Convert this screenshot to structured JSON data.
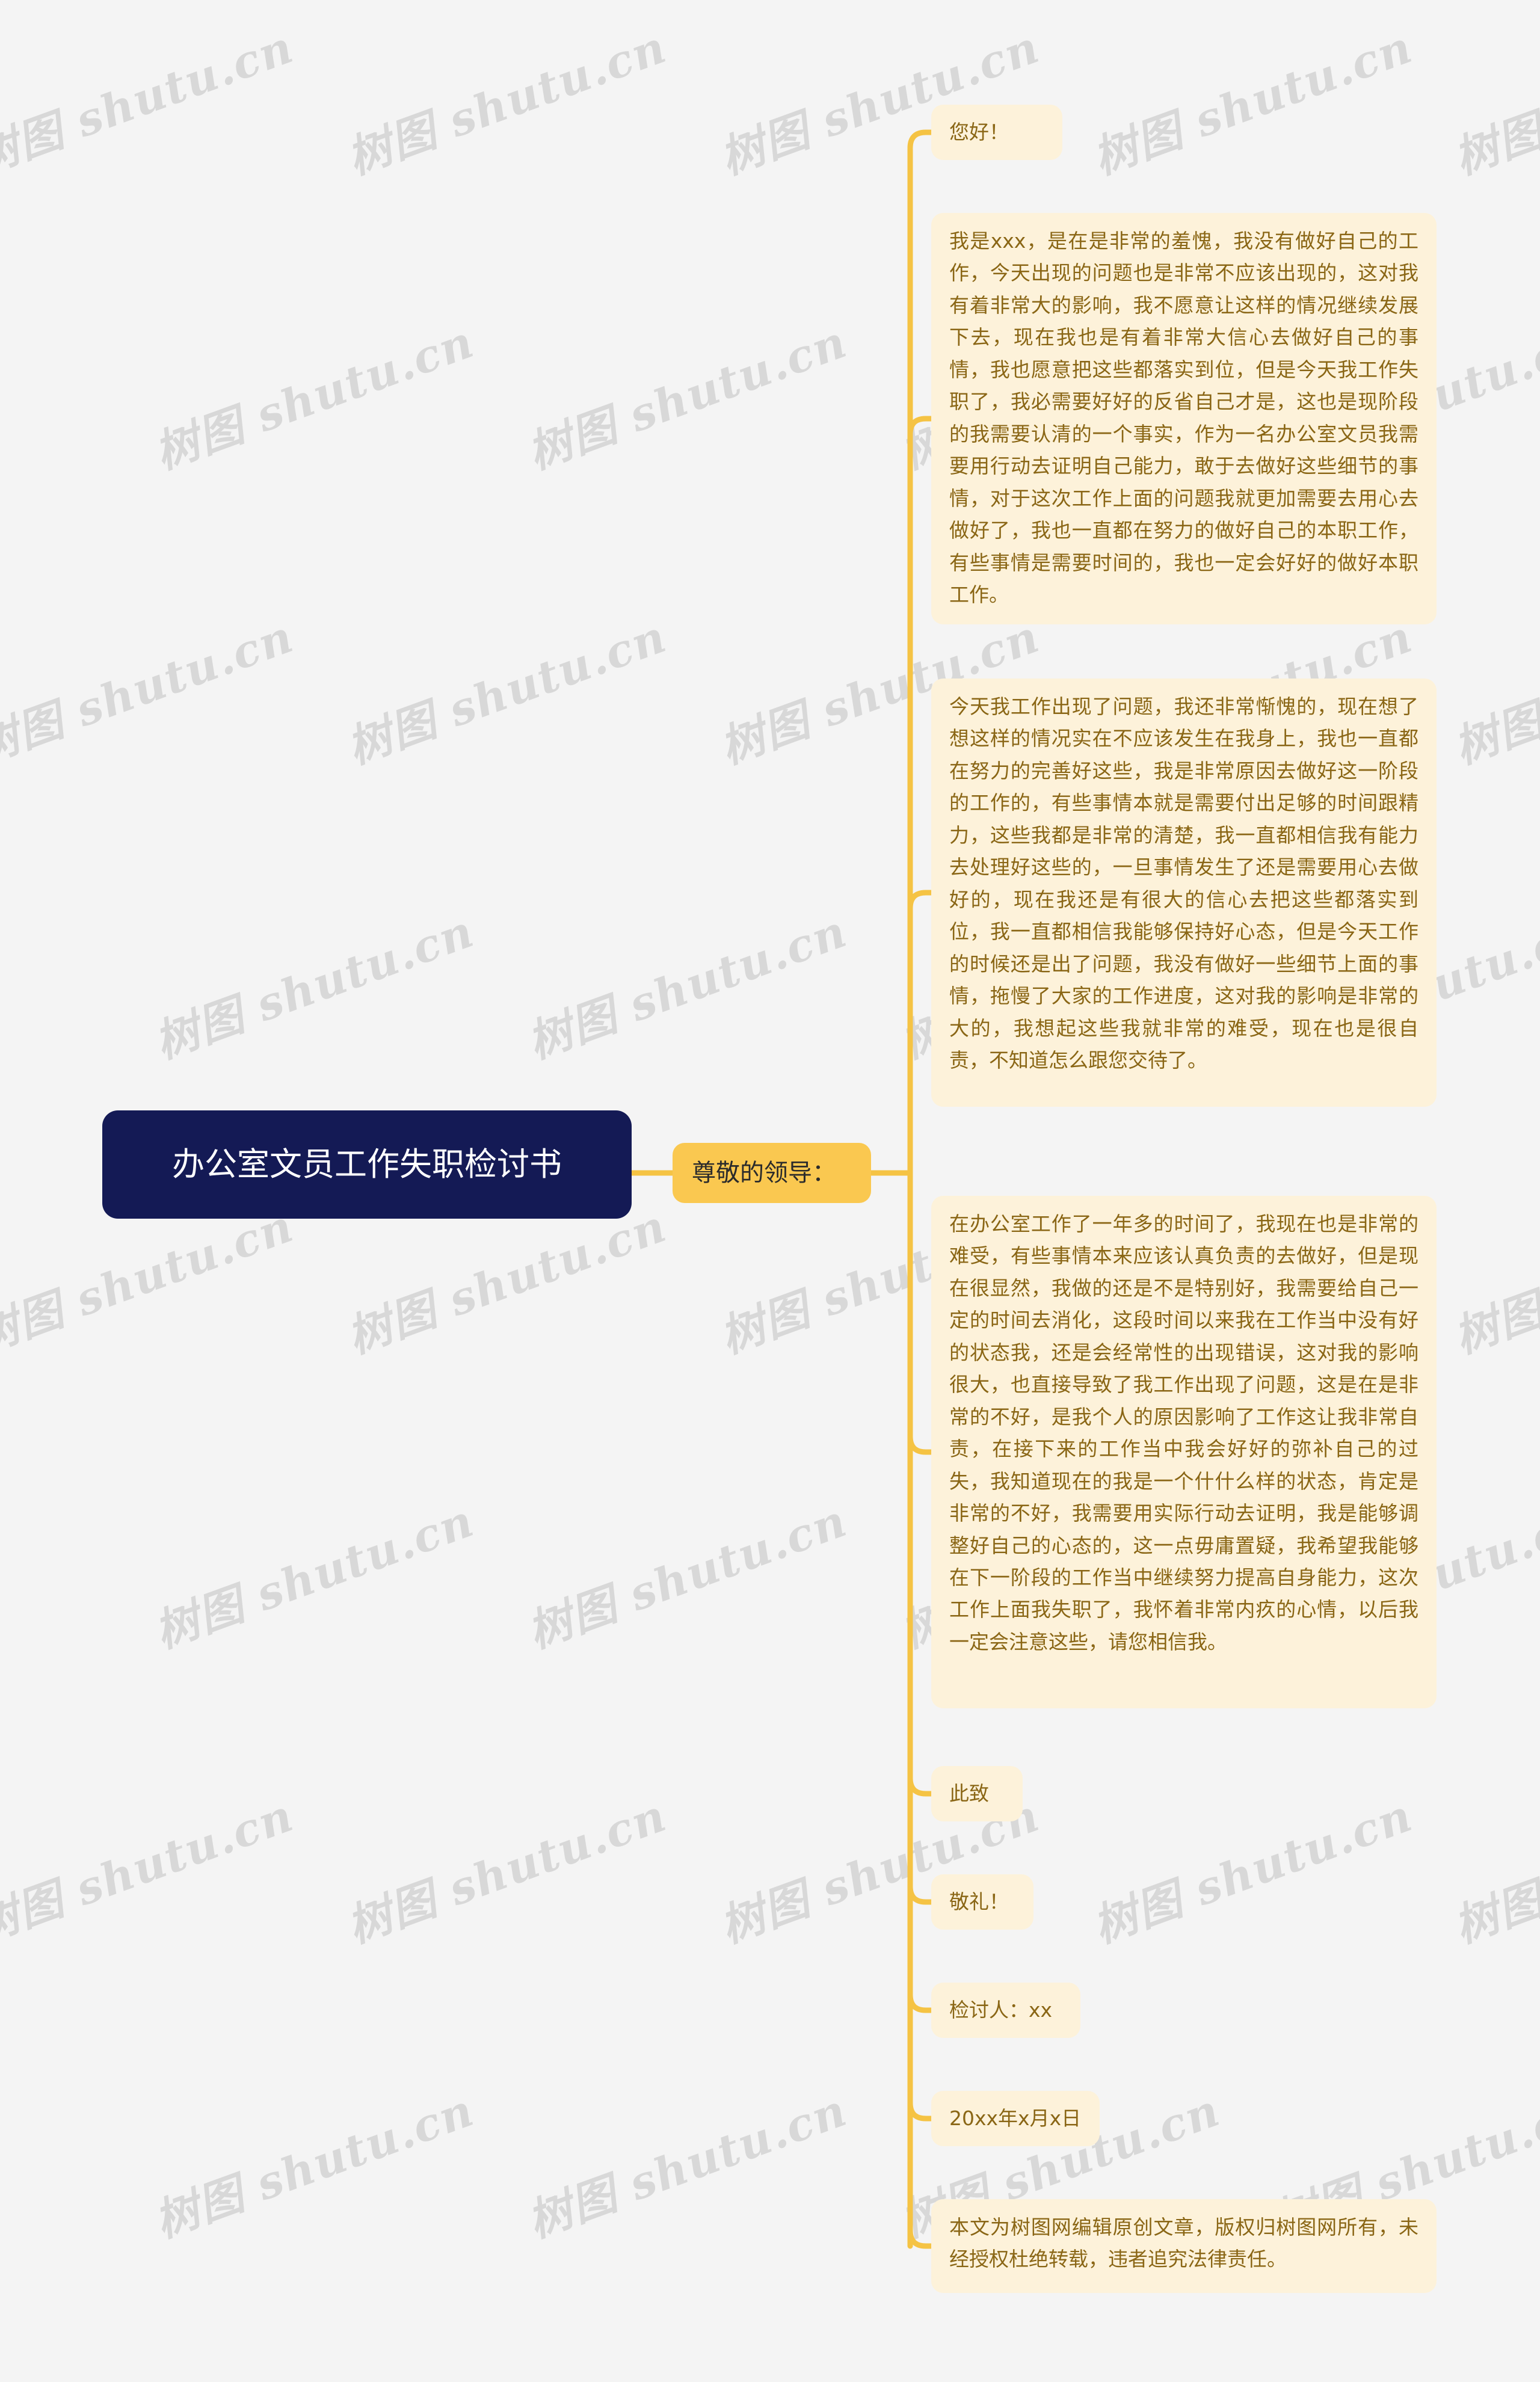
{
  "theme": {
    "canvas_background": "#f4f4f4",
    "root_background": "#141a55",
    "root_text": "#ffffff",
    "branch_background": "#fac850",
    "branch_text": "#2b2b2b",
    "leaf_background": "#fdf2da",
    "leaf_text": "#8a6615",
    "connector": "#f5c344"
  },
  "watermark": {
    "text": "树图 shutu.cn"
  },
  "mindmap": {
    "root": {
      "label": "办公室文员工作失职检讨书"
    },
    "branch": {
      "label": "尊敬的领导："
    },
    "leaves": [
      {
        "id": "greeting",
        "label": "您好！"
      },
      {
        "id": "paragraph-1",
        "label": "我是xxx，是在是非常的羞愧，我没有做好自己的工作，今天出现的问题也是非常不应该出现的，这对我有着非常大的影响，我不愿意让这样的情况继续发展下去，现在我也是有着非常大信心去做好自己的事情，我也愿意把这些都落实到位，但是今天我工作失职了，我必需要好好的反省自己才是，这也是现阶段的我需要认清的一个事实，作为一名办公室文员我需要用行动去证明自己能力，敢于去做好这些细节的事情，对于这次工作上面的问题我就更加需要去用心去做好了，我也一直都在努力的做好自己的本职工作，有些事情是需要时间的，我也一定会好好的做好本职工作。"
      },
      {
        "id": "paragraph-2",
        "label": "今天我工作出现了问题，我还非常惭愧的，现在想了想这样的情况实在不应该发生在我身上，我也一直都在努力的完善好这些，我是非常原因去做好这一阶段的工作的，有些事情本就是需要付出足够的时间跟精力，这些我都是非常的清楚，我一直都相信我有能力去处理好这些的，一旦事情发生了还是需要用心去做好的，现在我还是有很大的信心去把这些都落实到位，我一直都相信我能够保持好心态，但是今天工作的时候还是出了问题，我没有做好一些细节上面的事情，拖慢了大家的工作进度，这对我的影响是非常的大的，我想起这些我就非常的难受，现在也是很自责，不知道怎么跟您交待了。"
      },
      {
        "id": "paragraph-3",
        "label": "在办公室工作了一年多的时间了，我现在也是非常的难受，有些事情本来应该认真负责的去做好，但是现在很显然，我做的还是不是特别好，我需要给自己一定的时间去消化，这段时间以来我在工作当中没有好的状态我，还是会经常性的出现错误，这对我的影响很大，也直接导致了我工作出现了问题，这是在是非常的不好，是我个人的原因影响了工作这让我非常自责，在接下来的工作当中我会好好的弥补自己的过失，我知道现在的我是一个什什么样的状态，肯定是非常的不好，我需要用实际行动去证明，我是能够调整好自己的心态的，这一点毋庸置疑，我希望我能够在下一阶段的工作当中继续努力提高自身能力，这次工作上面我失职了，我怀着非常内疚的心情，以后我一定会注意这些，请您相信我。"
      },
      {
        "id": "closing-1",
        "label": "此致"
      },
      {
        "id": "closing-2",
        "label": "敬礼！"
      },
      {
        "id": "signer",
        "label": "检讨人：xx"
      },
      {
        "id": "date",
        "label": "20xx年x月x日"
      },
      {
        "id": "copyright",
        "label": "本文为树图网编辑原创文章，版权归树图网所有，未经授权杜绝转载，违者追究法律责任。"
      }
    ]
  }
}
